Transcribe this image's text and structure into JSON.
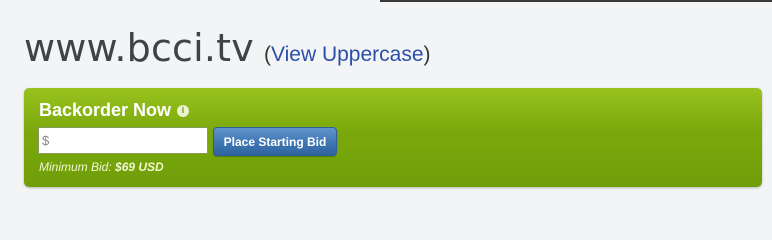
{
  "domain": {
    "title": "www.bcci.tv",
    "view_prefix": "(",
    "view_link": "View Uppercase",
    "view_suffix": ")"
  },
  "backorder": {
    "title": "Backorder Now",
    "info_icon": "info-icon",
    "bid_input_placeholder": "$",
    "bid_button_label": "Place Starting Bid",
    "min_bid_label": "Minimum Bid:",
    "min_bid_value": "$69 USD"
  },
  "colors": {
    "panel_green": "#7aa80c",
    "button_blue": "#3f76b3",
    "link_blue": "#2b4fa9",
    "title_gray": "#3f4346"
  }
}
